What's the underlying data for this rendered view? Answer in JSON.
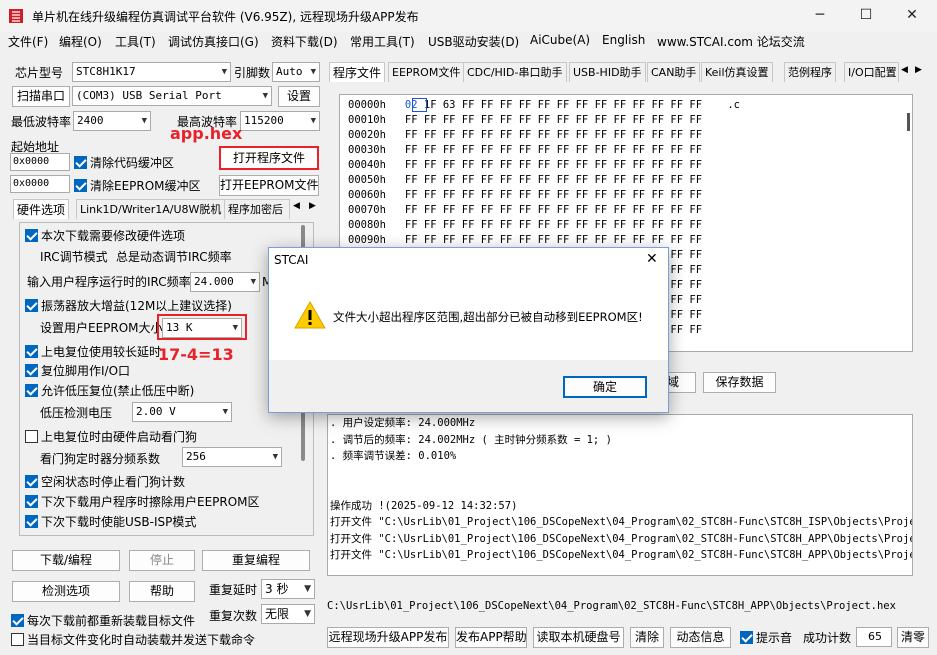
{
  "window": {
    "title": "单片机在线升级编程仿真调试平台软件 (V6.95Z), 远程现场升级APP发布",
    "minimize": "─",
    "maximize": "☐",
    "close": "✕"
  },
  "menu": [
    "文件(F)",
    "编程(O)",
    "工具(T)",
    "调试仿真接口(G)",
    "资料下载(D)",
    "常用工具(T)",
    "USB驱动安装(D)",
    "AiCube(A)",
    "English",
    "www.STCAI.com 论坛交流"
  ],
  "left": {
    "chip_label": "芯片型号",
    "chip_value": "STC8H1K17",
    "pin_label": "引脚数",
    "pin_value": "Auto",
    "scan_button": "扫描串口",
    "port_value": "(COM3) USB Serial Port",
    "settings_button": "设置",
    "min_baud_label": "最低波特率",
    "min_baud_value": "2400",
    "max_baud_label": "最高波特率",
    "max_baud_value": "115200",
    "start_addr_label": "起始地址",
    "addr1": "0x0000",
    "clear_code": "清除代码缓冲区",
    "open_prog": "打开程序文件",
    "addr2": "0x0000",
    "clear_eeprom": "清除EEPROM缓冲区",
    "open_eeprom": "打开EEPROM文件",
    "annotation_apphex": "app.hex",
    "annotation_calc": "17-4=13",
    "tabs": [
      "硬件选项",
      "Link1D/Writer1A/U8W脱机",
      "程序加密后"
    ],
    "options": {
      "opt1": "本次下载需要修改硬件选项",
      "irc_mode_label": "IRC调节模式",
      "irc_mode_value": "总是动态调节IRC频率",
      "irc_freq_label": "输入用户程序运行时的IRC频率",
      "irc_freq_value": "24.000",
      "irc_unit": "M",
      "opt2": "振荡器放大增益(12M以上建议选择)",
      "eeprom_size_label": "设置用户EEPROM大小",
      "eeprom_size_value": "13   K",
      "opt3": "上电复位使用较长延时",
      "opt4": "复位脚用作I/O口",
      "opt5": "允许低压复位(禁止低压中断)",
      "lvd_label": "低压检测电压",
      "lvd_value": "2.00 V",
      "opt6": "上电复位时由硬件启动看门狗",
      "wdt_label": "看门狗定时器分频系数",
      "wdt_value": "256",
      "opt7": "空闲状态时停止看门狗计数",
      "opt8": "下次下载用户程序时擦除用户EEPROM区",
      "opt9": "下次下载时使能USB-ISP模式"
    },
    "download_button": "下载/编程",
    "stop_button": "停止",
    "reprog_button": "重复编程",
    "check_button": "检测选项",
    "help_button": "帮助",
    "repeat_delay_label": "重复延时",
    "repeat_delay_value": "3 秒",
    "repeat_count_label": "重复次数",
    "repeat_count_value": "无限",
    "reload_label": "每次下载前都重新装载目标文件",
    "auto_label": "当目标文件变化时自动装载并发送下载命令"
  },
  "right": {
    "tabs": [
      "程序文件",
      "EEPROM文件",
      "CDC/HID-串口助手",
      "USB-HID助手",
      "CAN助手",
      "Keil仿真设置",
      "范例程序",
      "I/O口配置"
    ],
    "hex_addrs": [
      "00000h",
      "00010h",
      "00020h",
      "00030h",
      "00040h",
      "00050h",
      "00060h",
      "00070h",
      "00080h",
      "00090h",
      "000A0h",
      "000B0h",
      "000C0h",
      "000D0h",
      "000E0h",
      "000F0h"
    ],
    "hex_first": "02",
    "hex_first_rest": "1F 63 FF FF FF FF FF FF FF FF FF FF FF FF FF",
    "hex_ff": "FF FF FF FF FF FF FF FF FF FF FF FF FF FF FF FF",
    "ascii_first": ".c",
    "region_button": "域",
    "save_button": "保存数据",
    "log": [
      ". 用户设定频率: 24.000MHz",
      ". 调节后的频率: 24.002MHz ( 主时钟分频系数 = 1; )",
      ". 频率调节误差: 0.010%",
      "",
      "",
      "操作成功 !(2025-09-12 14:32:57)",
      "打开文件 \"C:\\UsrLib\\01_Project\\106_DSCopeNext\\04_Program\\02_STC8H-Func\\STC8H_ISP\\Objects\\Project.h",
      "打开文件 \"C:\\UsrLib\\01_Project\\106_DSCopeNext\\04_Program\\02_STC8H-Func\\STC8H_APP\\Objects\\Project.h",
      "打开文件 \"C:\\UsrLib\\01_Project\\106_DSCopeNext\\04_Program\\02_STC8H-Func\\STC8H_APP\\Objects\\Project.h"
    ],
    "path": "C:\\UsrLib\\01_Project\\106_DSCopeNext\\04_Program\\02_STC8H-Func\\STC8H_APP\\Objects\\Project.hex",
    "btn_remote": "远程现场升级APP发布",
    "btn_help": "发布APP帮助",
    "btn_read": "读取本机硬盘号",
    "btn_clear": "清除",
    "btn_dynamic": "动态信息",
    "beep_label": "提示音",
    "success_label": "成功计数",
    "success_count": "65",
    "btn_clear2": "清零"
  },
  "dialog": {
    "title": "STCAI",
    "message": "文件大小超出程序区范围,超出部分已被自动移到EEPROM区!",
    "ok": "确定"
  }
}
